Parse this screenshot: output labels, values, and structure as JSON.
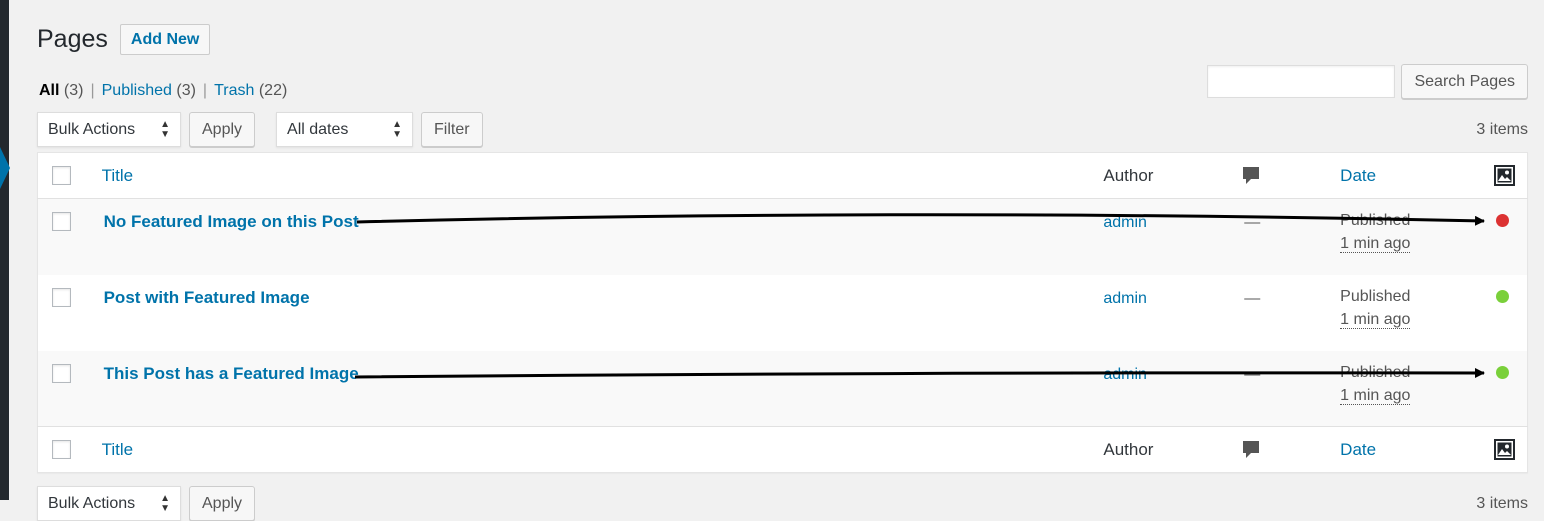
{
  "header": {
    "title": "Pages",
    "add_new_label": "Add New"
  },
  "filters": [
    {
      "label": "All",
      "count": "(3)",
      "current": true
    },
    {
      "label": "Published",
      "count": "(3)",
      "current": false
    },
    {
      "label": "Trash",
      "count": "(22)",
      "current": false
    }
  ],
  "filters_separator": "|",
  "search": {
    "value": "",
    "placeholder": "",
    "button_label": "Search Pages"
  },
  "tablenav": {
    "bulk_actions": "Bulk Actions",
    "apply_label": "Apply",
    "dates": "All dates",
    "filter_label": "Filter",
    "items_count": "3 items"
  },
  "table": {
    "columns": {
      "title": "Title",
      "author": "Author",
      "date": "Date"
    },
    "comment_icon": "comment-bubble-icon",
    "thumbnail_icon": "image-icon",
    "rows": [
      {
        "title": "No Featured Image on this Post",
        "author": "admin",
        "comments": "—",
        "status": "Published",
        "ago": "1 min ago",
        "featured": false,
        "dot_color": "#dc3232"
      },
      {
        "title": "Post with Featured Image",
        "author": "admin",
        "comments": "—",
        "status": "Published",
        "ago": "1 min ago",
        "featured": true,
        "dot_color": "#7ad03a"
      },
      {
        "title": "This Post has a Featured Image",
        "author": "admin",
        "comments": "—",
        "status": "Published",
        "ago": "1 min ago",
        "featured": true,
        "dot_color": "#7ad03a"
      }
    ]
  },
  "colors": {
    "link": "#0073aa",
    "sidebar": "#23282d",
    "sidebar_accent": "#0073aa"
  }
}
